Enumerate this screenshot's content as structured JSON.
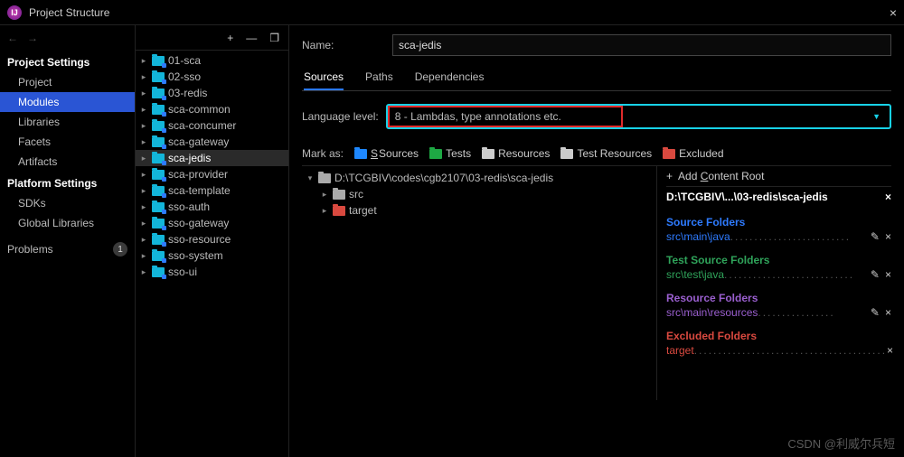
{
  "window": {
    "title": "Project Structure",
    "close": "×"
  },
  "nav": {
    "back": "←",
    "fwd": "→"
  },
  "sections": {
    "projectSettings": "Project Settings",
    "items": [
      "Project",
      "Modules",
      "Libraries",
      "Facets",
      "Artifacts"
    ],
    "platformSettings": "Platform Settings",
    "pitems": [
      "SDKs",
      "Global Libraries"
    ],
    "problems": "Problems",
    "badge": "1"
  },
  "toolbar": {
    "add": "+",
    "remove": "—",
    "copy": "❐"
  },
  "modules": [
    "01-sca",
    "02-sso",
    "03-redis",
    "sca-common",
    "sca-concumer",
    "sca-gateway",
    "sca-jedis",
    "sca-provider",
    "sca-template",
    "sso-auth",
    "sso-gateway",
    "sso-resource",
    "sso-system",
    "sso-ui"
  ],
  "form": {
    "nameLabel": "Name:",
    "nameValue": "sca-jedis"
  },
  "tabs": [
    "Sources",
    "Paths",
    "Dependencies"
  ],
  "lang": {
    "label": "Language level:",
    "value": "8 - Lambdas, type annotations etc."
  },
  "mark": {
    "label": "Mark as:",
    "sources": "Sources",
    "tests": "Tests",
    "resources": "Resources",
    "testResources": "Test Resources",
    "excluded": "Excluded"
  },
  "tree": {
    "root": "D:\\TCGBIV\\codes\\cgb2107\\03-redis\\sca-jedis",
    "src": "src",
    "target": "target"
  },
  "content": {
    "addRoot": "Add Content Root",
    "path": "D:\\TCGBIV\\...\\03-redis\\sca-jedis",
    "sourceFolders": "Source Folders",
    "srcMain": "src\\main\\java",
    "testFolders": "Test Source Folders",
    "srcTest": "src\\test\\java",
    "resFolders": "Resource Folders",
    "srcRes": "src\\main\\resources",
    "excFolders": "Excluded Folders",
    "targetItem": "target"
  },
  "watermark": "CSDN @利威尔兵短"
}
